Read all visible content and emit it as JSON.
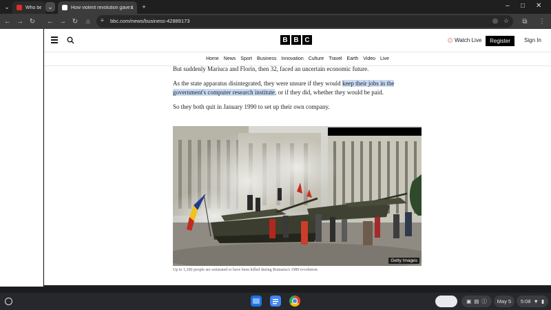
{
  "browser": {
    "tabs": [
      {
        "title": "Who belie",
        "active": false,
        "favicon_color": "#d93025"
      },
      {
        "title": "How violent revolution gave b",
        "active": true,
        "favicon_color": "#ffffff"
      }
    ],
    "tab_group_chevron": "⌄",
    "new_tab": "+",
    "url": "bbc.com/news/business-42889173"
  },
  "bbc": {
    "logo_letters": [
      "B",
      "B",
      "C"
    ],
    "watch_live": "Watch Live",
    "register": "Register",
    "sign_in": "Sign In",
    "nav": [
      "Home",
      "News",
      "Sport",
      "Business",
      "Innovation",
      "Culture",
      "Travel",
      "Earth",
      "Video",
      "Live"
    ]
  },
  "article": {
    "para1": "But suddenly Mariuca and Florin, then 32, faced an uncertain economic future.",
    "para2_start": "As the state apparatus disintegrated, they were unsure if they would ",
    "para2_highlight": "keep their jobs in the government's computer research institute",
    "para2_end": "; or if they did, whether they would be paid.",
    "para3": "So they both quit in January 1990 to set up their own company.",
    "image_credit": "Getty Images",
    "caption": "Up to 1,200 people are estimated to have been killed during Romania's 1989 revolution"
  },
  "shelf": {
    "date": "May 5",
    "time": "5:08"
  }
}
